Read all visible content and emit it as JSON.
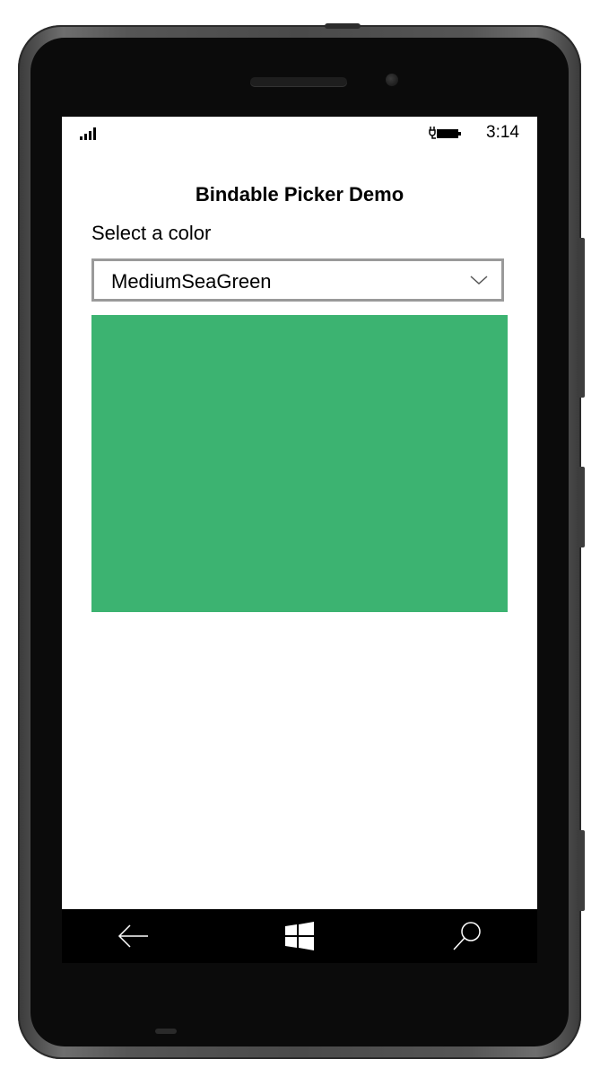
{
  "status_bar": {
    "time": "3:14",
    "signal_icon": "signal-bars-icon",
    "battery_icon": "battery-charging-icon"
  },
  "page": {
    "title": "Bindable Picker Demo",
    "picker_label": "Select a color",
    "picker_selected": "MediumSeaGreen",
    "picker_icon": "chevron-down-icon"
  },
  "color_preview": {
    "color": "#3CB371"
  },
  "nav_bar": {
    "back_icon": "back-arrow-icon",
    "home_icon": "windows-logo-icon",
    "search_icon": "search-icon"
  }
}
